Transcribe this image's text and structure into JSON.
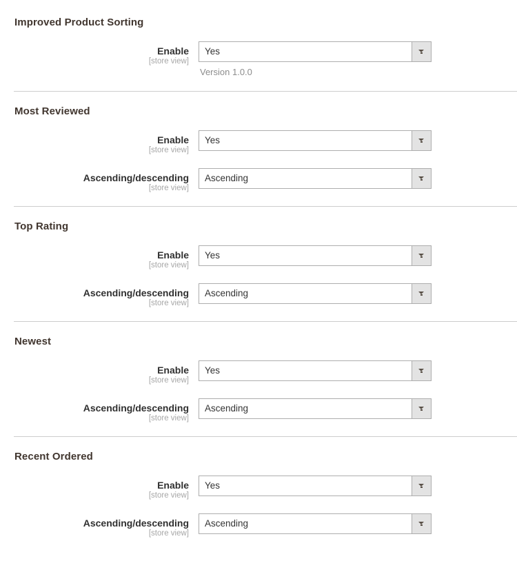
{
  "labels": {
    "enable": "Enable",
    "direction": "Ascending/descending",
    "scope": "[store view]"
  },
  "sections": [
    {
      "title": "Improved Product Sorting",
      "has_divider": false,
      "fields": [
        {
          "label": "Enable",
          "scope": "[store view]",
          "value": "Yes",
          "note": "Version 1.0.0"
        }
      ]
    },
    {
      "title": "Most Reviewed",
      "has_divider": true,
      "fields": [
        {
          "label": "Enable",
          "scope": "[store view]",
          "value": "Yes",
          "note": ""
        },
        {
          "label": "Ascending/descending",
          "scope": "[store view]",
          "value": "Ascending",
          "note": ""
        }
      ]
    },
    {
      "title": "Top Rating",
      "has_divider": true,
      "fields": [
        {
          "label": "Enable",
          "scope": "[store view]",
          "value": "Yes",
          "note": ""
        },
        {
          "label": "Ascending/descending",
          "scope": "[store view]",
          "value": "Ascending",
          "note": ""
        }
      ]
    },
    {
      "title": "Newest",
      "has_divider": true,
      "fields": [
        {
          "label": "Enable",
          "scope": "[store view]",
          "value": "Yes",
          "note": ""
        },
        {
          "label": "Ascending/descending",
          "scope": "[store view]",
          "value": "Ascending",
          "note": ""
        }
      ]
    },
    {
      "title": "Recent Ordered",
      "has_divider": true,
      "fields": [
        {
          "label": "Enable",
          "scope": "[store view]",
          "value": "Yes",
          "note": ""
        },
        {
          "label": "Ascending/descending",
          "scope": "[store view]",
          "value": "Ascending",
          "note": ""
        }
      ]
    }
  ],
  "colors": {
    "heading": "#41362f",
    "label": "#303030",
    "scope": "#a6a6a6",
    "note": "#8c8c8c",
    "border": "#adadad",
    "divider": "#cccccc",
    "button_face": "#e3e3e3"
  },
  "icons": {
    "select_arrow": "chevron-down-icon"
  }
}
